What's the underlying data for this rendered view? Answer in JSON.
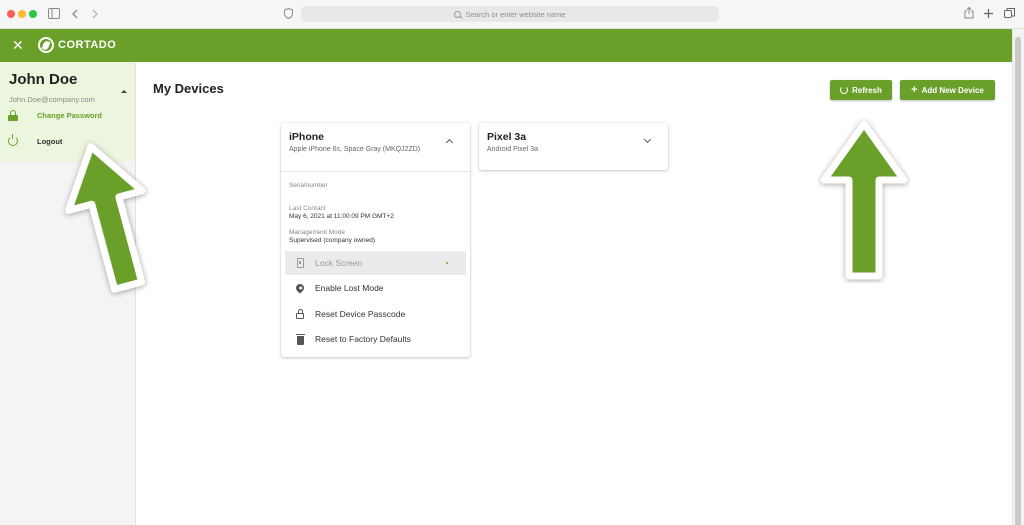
{
  "browser": {
    "url_placeholder": "Search or enter website name",
    "icons": [
      "sidebar-icon",
      "back-icon",
      "forward-icon",
      "shield-icon",
      "share-icon",
      "new-tab-icon",
      "tabs-icon"
    ]
  },
  "app": {
    "brand": "CORTADO",
    "close_icon": "✕",
    "accent_color": "#6a9f2a"
  },
  "user": {
    "name": "John Doe",
    "email": "John.Doe@company.com",
    "menu": [
      {
        "label": "Change Password",
        "icon": "lock-icon"
      },
      {
        "label": "Logout",
        "icon": "power-icon"
      }
    ]
  },
  "main": {
    "title": "My Devices",
    "buttons": {
      "refresh": "Refresh",
      "add_device": "Add New Device"
    }
  },
  "devices": [
    {
      "name": "iPhone",
      "model": "Apple iPhone 6s, Space Gray (MKQJ2ZD)",
      "expanded": true,
      "details": [
        {
          "label": "Serialnumber",
          "value": ""
        },
        {
          "label": "Last Contact",
          "value": "May 6, 2021 at 11:00:09 PM GMT+2"
        },
        {
          "label": "Management Mode",
          "value": "Supervised (company owned)"
        }
      ],
      "actions": [
        {
          "label": "Lock Screen",
          "icon": "phone-icon",
          "disabled": true
        },
        {
          "label": "Enable Lost Mode",
          "icon": "location-pin-icon",
          "disabled": false
        },
        {
          "label": "Reset Device Passcode",
          "icon": "lock-icon",
          "disabled": false
        },
        {
          "label": "Reset to Factory Defaults",
          "icon": "trash-icon",
          "disabled": false
        }
      ]
    },
    {
      "name": "Pixel 3a",
      "model": "Android Pixel 3a",
      "expanded": false
    }
  ]
}
